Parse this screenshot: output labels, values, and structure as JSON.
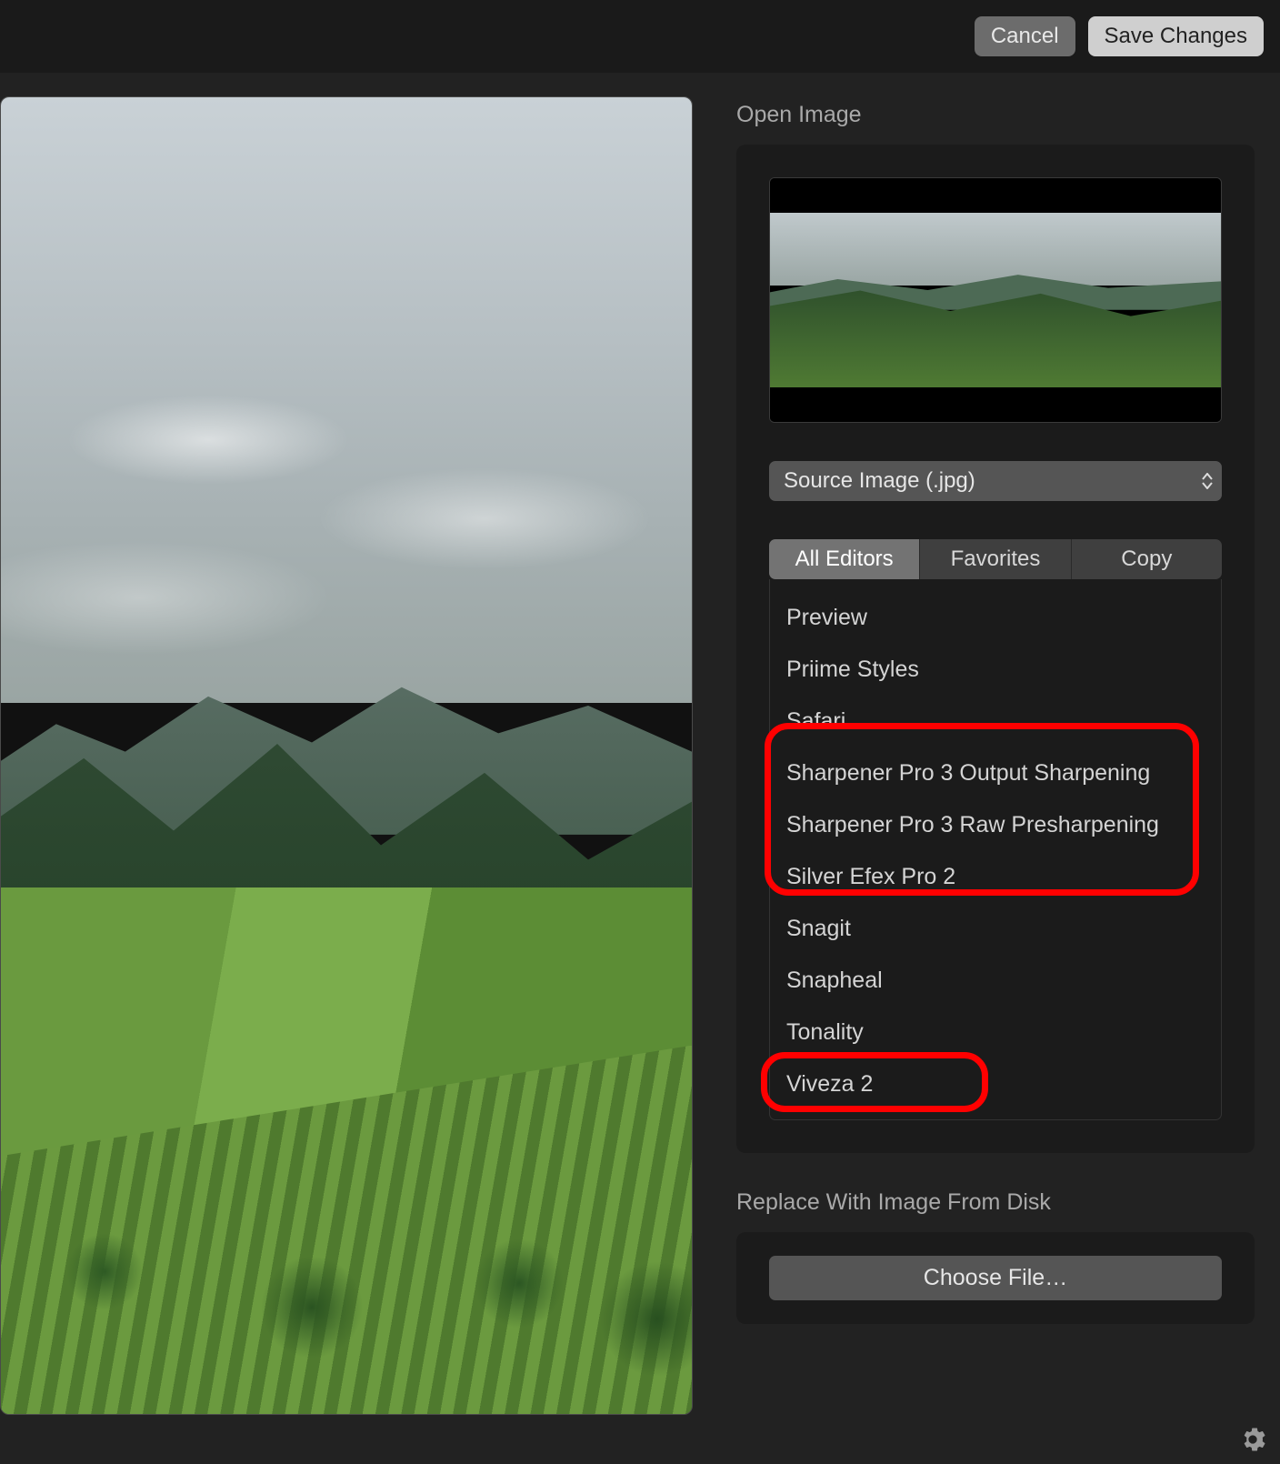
{
  "toolbar": {
    "cancel_label": "Cancel",
    "save_label": "Save Changes"
  },
  "side": {
    "open_image_heading": "Open Image",
    "source_select_value": "Source Image (.jpg)",
    "segmented": {
      "all_editors": "All Editors",
      "favorites": "Favorites",
      "copy": "Copy",
      "active": "all_editors"
    },
    "editors": [
      {
        "label": "Preview",
        "highlight": false
      },
      {
        "label": "Priime Styles",
        "highlight": false
      },
      {
        "label": "Safari",
        "highlight": false
      },
      {
        "label": "Sharpener Pro 3 Output Sharpening",
        "highlight": true,
        "group": 1
      },
      {
        "label": "Sharpener Pro 3 Raw Presharpening",
        "highlight": true,
        "group": 1
      },
      {
        "label": "Silver Efex Pro 2",
        "highlight": true,
        "group": 1
      },
      {
        "label": "Snagit",
        "highlight": false
      },
      {
        "label": "Snapheal",
        "highlight": false
      },
      {
        "label": "Tonality",
        "highlight": false
      },
      {
        "label": "Viveza 2",
        "highlight": true,
        "group": 2
      }
    ],
    "replace_heading": "Replace With Image From Disk",
    "choose_file_label": "Choose File…"
  },
  "icons": {
    "gear": "gear-icon",
    "stepper": "updown-stepper-icon"
  }
}
